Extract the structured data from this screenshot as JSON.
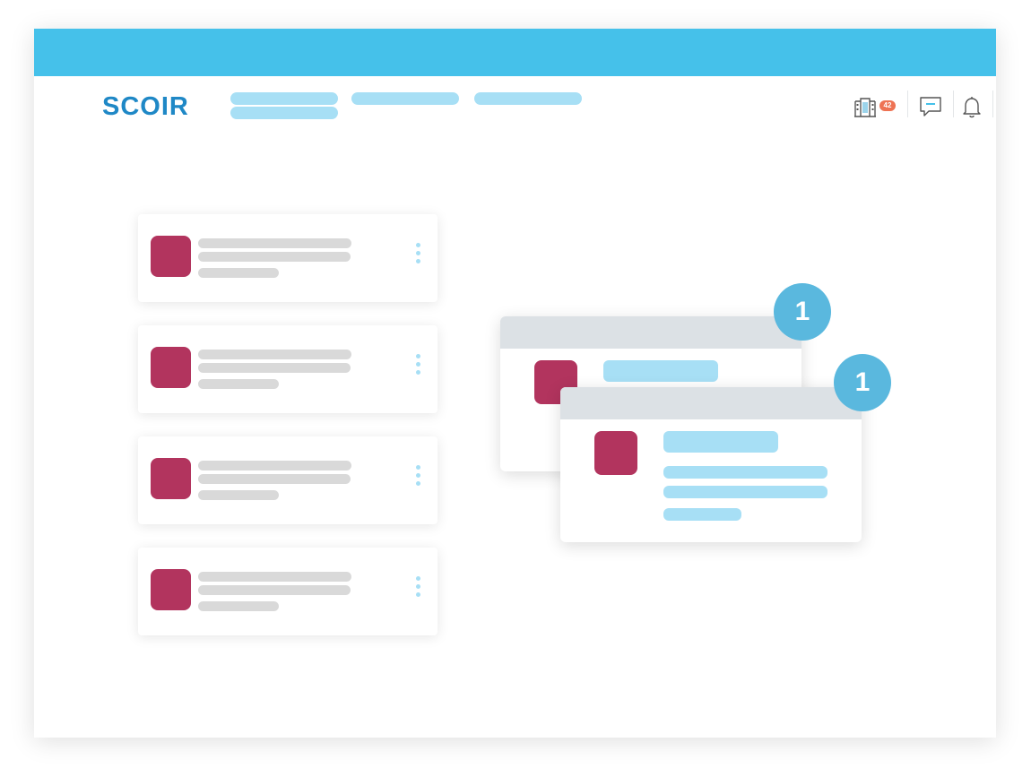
{
  "header": {
    "logo_text": "SCOIR",
    "badge_count": "42",
    "accent_color": "#45c1ea",
    "icons": [
      "building-icon",
      "message-icon",
      "bell-icon"
    ]
  },
  "notifications": [
    {
      "count": "1"
    },
    {
      "count": "1"
    }
  ],
  "colors": {
    "avatar": "#b2345e",
    "placeholder_blue": "#a7dff5",
    "placeholder_gray": "#d9d9d9",
    "count_badge": "#5ab8de"
  }
}
